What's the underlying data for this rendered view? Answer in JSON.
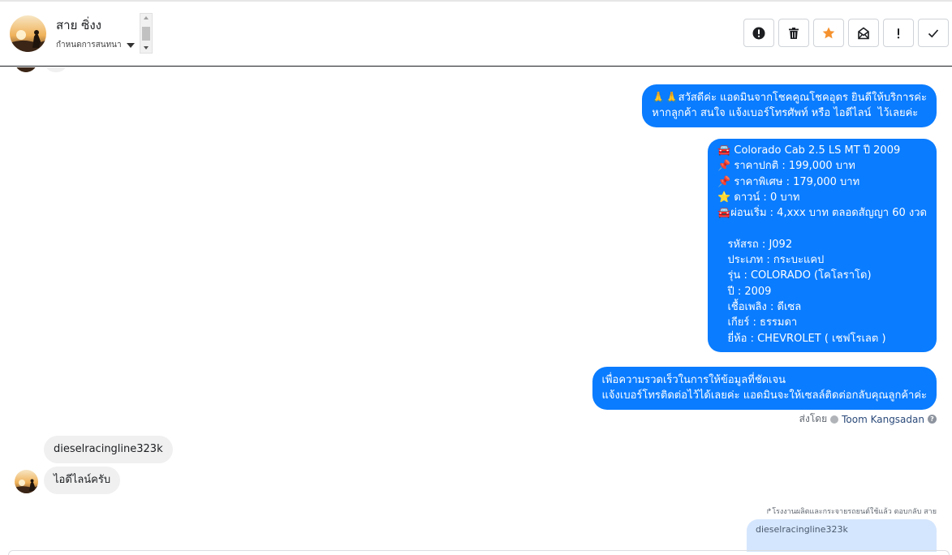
{
  "header": {
    "contact_name": "สาย ซิ่งง",
    "conversation_label": "กำหนดการสนทนา",
    "actions": [
      {
        "name": "report-spam-button",
        "icon": "exclamation-circle-icon"
      },
      {
        "name": "delete-button",
        "icon": "trash-icon"
      },
      {
        "name": "star-button",
        "icon": "star-icon",
        "color": "#f5922f"
      },
      {
        "name": "mark-unread-button",
        "icon": "envelope-icon"
      },
      {
        "name": "important-button",
        "icon": "exclamation-icon"
      },
      {
        "name": "done-button",
        "icon": "check-icon"
      }
    ]
  },
  "messages": {
    "greeting": {
      "line1": "🙏🙏สวัสดีค่ะ แอดมินจากโชคคูณโชคอุดร ยินดีให้บริการค่ะ",
      "line2": "หากลูกค้า สนใจ แจ้งเบอร์โทรศัพท์ หรือ ไอดีไลน์  ไว้เลยค่ะ"
    },
    "listing": {
      "title": "Colorado Cab 2.5 LS MT ปี 2009",
      "price_normal": "ราคาปกติ : 199,000 บาท",
      "price_special": "ราคาพิเศษ : 179,000 บาท",
      "down": "ดาวน์ : 0 บาท",
      "installment": "ผ่อนเริ่ม : 4,xxx บาท ตลอดสัญญา 60 งวด",
      "code": "รหัสรถ : J092",
      "type": "ประเภท : กระบะแคป",
      "model": "รุ่น : COLORADO (โคโลราโด)",
      "year": "ปี : 2009",
      "fuel": "เชื้อเพลิง : ดีเซล",
      "gear": "เกียร์ : ธรรมดา",
      "brand": "ยี่ห้อ : CHEVROLET ( เชฟโรเลต )"
    },
    "contact_request": {
      "line1": "เพื่อความรวดเร็วในการให้ข้อมูลที่ชัดเจน",
      "line2": "แจ้งเบอร์โทรติดต่อไว้ได้เลยค่ะ แอดมินจะให้เซลล์ติดต่อกลับคุณลูกค้าค่ะ"
    },
    "sent_by_label": "ส่งโดย",
    "sent_by_name": "Toom Kangsadan",
    "incoming": [
      "dieselracingline323k",
      "ไอดีไลน์ครับ"
    ],
    "reply_note": "โรงงานผลิตและกระจายรถยนต์ใช้แล้ว ตอบกลับ สาย",
    "reply_quote": "dieselracingline323k"
  },
  "colors": {
    "outgoing_bubble": "#0a7cff",
    "incoming_bubble": "#f0f0f0",
    "reply_bubble": "#d4e6fd"
  }
}
